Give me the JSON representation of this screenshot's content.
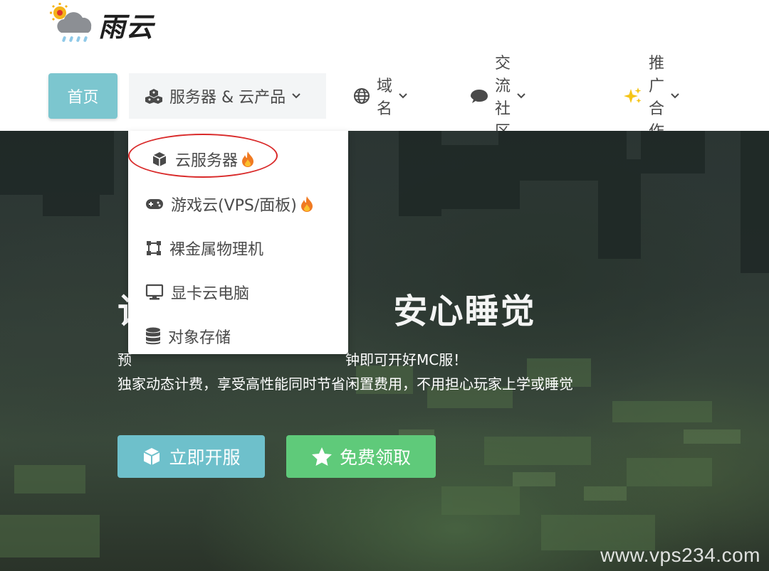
{
  "header": {
    "logo_text": "雨云"
  },
  "nav": {
    "home": "首页",
    "servers": "服务器 & 云产品",
    "domain": "域名",
    "community": "交流社区",
    "promo": "推广合作"
  },
  "dropdown": {
    "items": [
      {
        "label": "云服务器",
        "icon": "cube-icon",
        "hot": true
      },
      {
        "label": "游戏云(VPS/面板)",
        "icon": "gamepad-icon",
        "hot": true
      },
      {
        "label": "裸金属物理机",
        "icon": "bare-metal-icon",
        "hot": false
      },
      {
        "label": "显卡云电脑",
        "icon": "monitor-icon",
        "hot": false
      },
      {
        "label": "对象存储",
        "icon": "database-icon",
        "hot": false
      }
    ]
  },
  "hero": {
    "title_partial": "让",
    "title_main": "安心睡觉",
    "line1_left": "预",
    "line1_right": "钟即可开好MC服！",
    "line2": "独家动态计费，享受高性能同时节省闲置费用，不用担心玩家上学或睡觉",
    "btn_open": "立即开服",
    "btn_free": "免费领取"
  },
  "watermark": "www.vps234.com",
  "colors": {
    "home_bg": "#7cc6cf",
    "btn_open": "#6ec0cb",
    "btn_free": "#5fca7a",
    "highlight_circle": "#d92a2a"
  }
}
